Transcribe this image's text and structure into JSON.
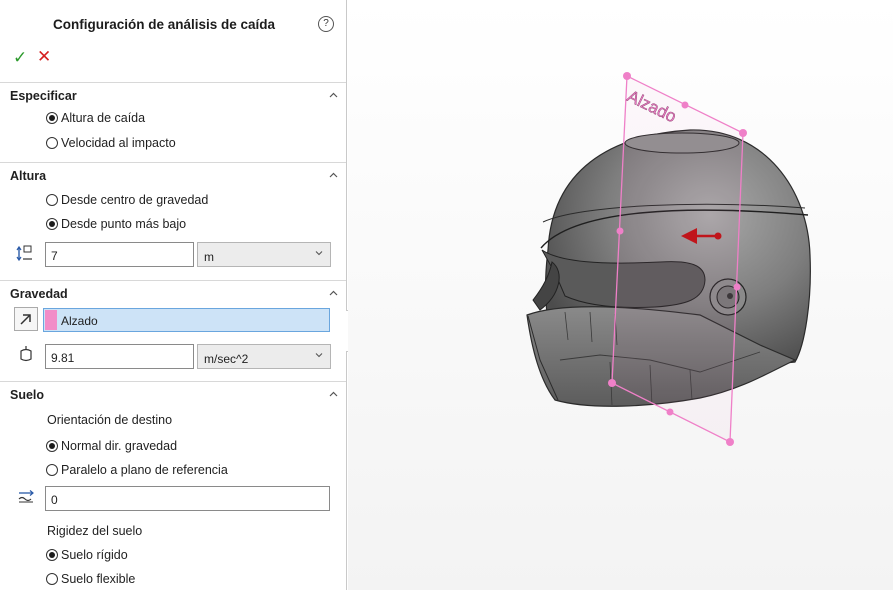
{
  "panel": {
    "title": "Configuración de análisis de caída",
    "help_symbol": "?",
    "ok_symbol": "✓",
    "cancel_symbol": "✕"
  },
  "specify": {
    "title": "Especificar",
    "options": [
      "Altura de caída",
      "Velocidad al impacto"
    ],
    "selected": 0
  },
  "height": {
    "title": "Altura",
    "options": [
      "Desde centro de gravedad",
      "Desde punto más bajo"
    ],
    "selected": 1,
    "value": "7",
    "unit": "m"
  },
  "gravity": {
    "title": "Gravedad",
    "reference": "Alzado",
    "reference_color": "#f28cc8",
    "value": "9.81",
    "unit": "m/sec^2"
  },
  "ground": {
    "title": "Suelo",
    "orientation_label": "Orientación de destino",
    "orientation_options": [
      "Normal dir. gravedad",
      "Paralelo a plano de referencia"
    ],
    "orientation_selected": 0,
    "offset_value": "0",
    "stiffness_label": "Rigidez del suelo",
    "stiffness_options": [
      "Suelo rígido",
      "Suelo flexible"
    ],
    "stiffness_selected": 0
  },
  "viewport": {
    "plane_label": "Alzado",
    "plane_color": "#ef80c8",
    "arrow_color": "#c0151b"
  }
}
